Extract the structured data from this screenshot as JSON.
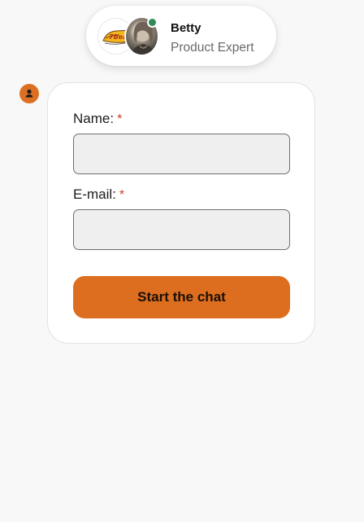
{
  "agent": {
    "name": "Betty",
    "role": "Product Expert",
    "status": "online",
    "logo_text": "7Bear",
    "status_color": "#2f8b57"
  },
  "form": {
    "name_label": "Name:",
    "email_label": "E-mail:",
    "required_mark": "*",
    "name_value": "",
    "email_value": "",
    "submit_label": "Start the chat"
  },
  "icons": {
    "user_bubble": "user-icon"
  },
  "colors": {
    "accent": "#dd6d1f",
    "required": "#d03c1f",
    "input_bg": "#efefef"
  }
}
